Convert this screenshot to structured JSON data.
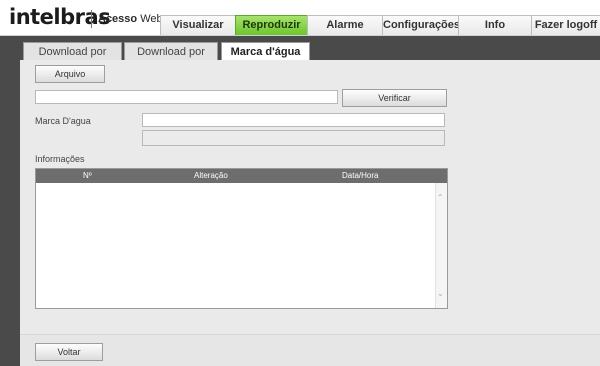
{
  "header": {
    "logo": "intelbras",
    "product_bold": "Acesso",
    "product_light": "Web"
  },
  "nav": {
    "tabs": [
      {
        "label": "Visualizar"
      },
      {
        "label": "Reproduzir"
      },
      {
        "label": "Alarme"
      },
      {
        "label": "Configurações"
      },
      {
        "label": "Info"
      },
      {
        "label": "Fazer logoff"
      }
    ],
    "active": "Reproduzir",
    "active_color": "#7fd13b"
  },
  "subtabs": {
    "items": [
      {
        "label": "Download por arquivo"
      },
      {
        "label": "Download por tempo"
      },
      {
        "label": "Marca d'água"
      }
    ],
    "active": "Marca d'água"
  },
  "form": {
    "arquivo_button": "Arquivo",
    "file_path": "",
    "verificar_button": "Verificar",
    "marca_label": "Marca D'agua",
    "marca_value": "",
    "result_value": "",
    "informacoes_label": "Informações"
  },
  "table": {
    "columns": [
      "Nº",
      "Alteração",
      "Data/Hora"
    ],
    "rows": []
  },
  "footer": {
    "voltar_button": "Voltar"
  }
}
